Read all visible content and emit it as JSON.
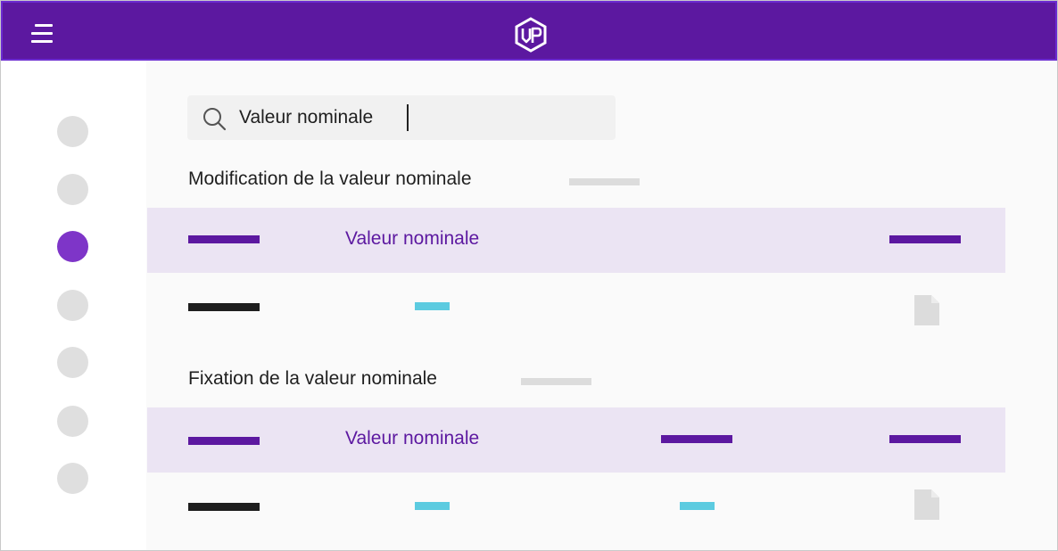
{
  "search": {
    "value": "Valeur nominale",
    "placeholder": ""
  },
  "sections": [
    {
      "title": "Modification de la valeur nominale",
      "column_label": "Valeur nominale"
    },
    {
      "title": "Fixation de la valeur nominale",
      "column_label": "Valeur nominale"
    }
  ],
  "sidebar": {
    "items_count": 7,
    "active_index": 2
  },
  "colors": {
    "brand": "#5c18a0",
    "active": "#7e35c8",
    "highlight_row": "#ebe4f3",
    "accent_cyan": "#5ccbe0"
  },
  "icons": {
    "menu": "hamburger-icon",
    "logo": "logo-icon",
    "search": "search-icon",
    "document": "document-icon"
  }
}
